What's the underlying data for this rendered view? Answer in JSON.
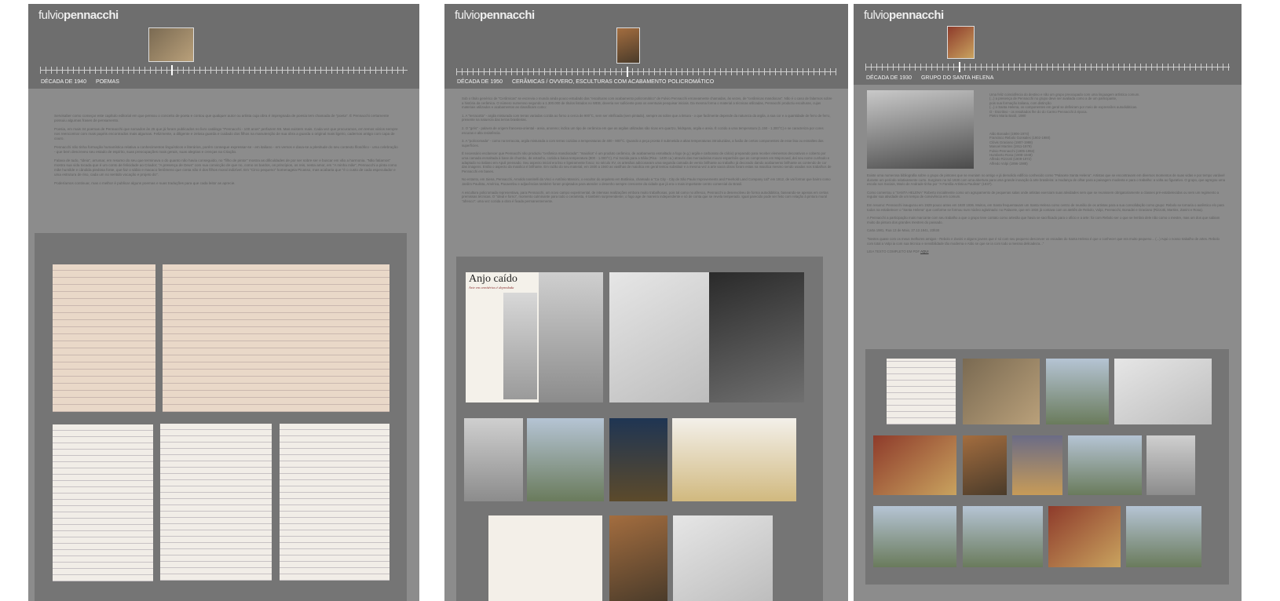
{
  "brand": {
    "part1": "fulvio",
    "part2": "pennacchi"
  },
  "panels": [
    {
      "nav": [
        "DÉCADA DE 1940",
        "POEMAS"
      ],
      "paragraphs": [
        "Servisaber como começar este capítulo editorial em que pensou o conceito de poeta e contou que qualquer autor ou artista cuja obra é impregnada de poesia tem chamada de \"poeta\". É Pennacchi certamente possuiu algumas frases de pensamento.",
        "Poesia, em mais 34 poemas de Pennacchi que somados às 25 que já foram publicados no livro catálogo \"Pennacchi - 100 anos\" perfazem 59. Mas existem mais. Cada vez que procuramos, em temos vários sempre nos reencontrar com mais papéis encontrados mais algumas. Felizmente, a diligente e zelosa guarda e cuidado dos filhos na manutenção de sua obra a guarda o original mais ligeiro, cadernos antigo com capa de couro.",
        "Pennacchi não tinha formação humanística relativa a conhecimentos linguísticos e literários, porém consegue expressar-se - em italiano - em versos e dava-se a plenitude do seu contexto filosófico - uma celebração - que bem descreveu seu estado de espírito, suas preocupações mais gerais, suas alegrias e crenças na Criação.",
        "Falava de tudo, \"ideia\", arrumar, em resumo do seu que terminava o do quanto não havia conseguido, no \"filho de pintor\" mostra as dificuldades de por ser sobre ser e buscar em vão a harmonia. \"Não fatiamos\" mostra sua vida tocada que é um conto de felicidade ao Criador; \"A presença de Deus\" com sua convicção de que no, como os bardos, os princípios, os reis, nesta amor, em \"A minha mãe\", Pennacchi a pinta como mãe humilde e cândida piedosa fonte, que faz o sábio e macaco fenômeno que conta não é dos filhos moral indizível. Em \"Circo pequeno\" homenageia Picasso, mas acabaria que \"é o custo de cada especulador e uma estrutura de riso, cada um no sentido vocação e projeto do\".",
        "Poderíamos continuar, mas o melhor é publicar alguns poemas e suas traduções para que cada leitor as aprecie."
      ]
    },
    {
      "nav": [
        "DÉCADA DE 1950",
        "CERÂMICAS / OVVERO, ESCULTURAS COM ACABAMENTO POLICROMÁTICO"
      ],
      "paragraphs": [
        "Sob o título genérico de \"Cerâmicas\" se escrevia o mundo ainda pouco estudado das \"esculturas com acabamento policromático\" de Fulvio Pennacchi erroneamente chamadas, às vezes, de \"cerâmicas mandiocas\". Não é o caso de falarmos sobre a história da cerâmica. O número numeroso segundo a 1.300.000 de títulos listados no WEB, deveria ser suficiente para os eventuais pesquisar iniciais. Da mesma forma o material a técnicas utilizadas, Pennacchi produziu esculturas, cujas materiais utilizados e acabamentos as classificam como:",
        "1. A \"terracotta\" - argila misturada com terras variadas cozida ao forno a cerca de 900°C, sem ser vitrificada (sem pintado), sempre as sobre que a tintura - o que facilmente depende da natureza da argila, a sua cor e a quantidade de ferro de ferro, presente na natureza das terras brasileiras.",
        "2. O \"grés\" - palavra de origem francesa-oriental - areia, anoreno; indica um tipo de cerâmica em que as argilas utilizadas são ricas em quartzo, feldspato, argila e areia. É cozido a uma temperatura (1.150 - 1.300°C) e se caracteriza por cores escuras e alta resistência.",
        "3. A \"policromada\" - como na terracota, argila misturada a com terras cozidas a temperaturas de 400 - 900°C. Quando a peça pronta é submetida a altas temperaturas introduzidas, a fusão de certos componentes de esse lisa ou esmaltes das superfícies.",
        "É necessário esclarecer que Pennacchi não produziu \"cerâmica mandiocada\": \"maiolica\" é um produto cerâmico, de acabamento esmaltado a fogo (e.g.) argila e carbonato de cálcio) preparado para receber elementos decorativos e coberto por uma camada esmaltada à base de chumbo, de estanho, cozida a baixa temperatura (800 - 1.000°C). Foi trazida para a Itália (Pisa - 1400 ca.) através das mercadorias mouro-espanhóis que as comprovam em Majorcaed, daí seu nome cunhado e adaptado no italiano em Apuli prensado. Seu aspecto inicial era liso e ligeiramente fosco; no século XV, os artesãos adicionaram uma segunda camada de vernix brilhante ao trabalho já decorado dando acabamento brilhante as contendo de cor das imagens. Então o aspecto da maiolica é brilhante. Em razão do seu material, em 1930 a 1940 as vasilhas de maiolica em geral tentou substituir e a mesma vez a arte sacra obras foram estas na maiolica mesmo sendo usadas nos trabalhos de Pennacchi em bases.",
        "No entanto, em Siena, Pennacchi, Arnoldo Iannitelli da Vinci e Antônio Mancini, o escultor do arquiteto em Botânica, chamado a \"Ca City - City de São Paulo Improvements and Freehold Land Company Ltd\" em 1912, de vai formar que bairro como Jardim Paulista, América, Pacaembu e adjacências também foram projetados para atender o desenho sempre crescente da cidade que já era o mais importante centro comercial do Brasil.",
        "A escultura policromada representava, para Pennacchi, um novo campo experimental, de intensas realizações embora muito trabalhosas, pois tal como no afresco, Pennacchi a desenvolveu de forma autodidática, baseando-se apenas em certas premissas técnicas. O \"ideal e forno\", momento culminante para todo o ceramista, é também surpreendente; o fogo age de maneira independente e só de conta que se revela temperado. Igual parecido pode ser feito com relação à pintura mural \"afresco\": uma vez cozida a obra é fixada permanentemente."
      ]
    },
    {
      "nav": [
        "DÉCADA DE 1930",
        "GRUPO DO SANTA HELENA"
      ],
      "side_text": [
        "Uma feliz coincidência do destino e não um grupo preocupado com uma linguagem artística comum.",
        "(...) a presença de Pennacchi no grupo deve ser avaliada como a de um participante,",
        "pois sua formação italiana, com distinção",
        "(...) o Santa Helena, os componentes em geral se definiram por meio de expressões autodidáticas.",
        "O - Escritivo - os resultados lhe do do Carmo Pennacchi à época.",
        "Pietro Maria Bardi, 1980"
      ],
      "members": [
        "Aldo Bonadei (1906-1974)",
        "Francisco Rebolo Gonsales (1902-1980)",
        "Clóvis Graciano (1907-1988)",
        "Manoel Martins (1911-1979)",
        "Fulvio Pennacchi (1905-1992)",
        "Humberto Rosa (1908-1948)",
        "Alfredo Rizzotti (1909-1972)",
        "Alfredo Volpi (1896-1988)"
      ],
      "paragraphs": [
        "Existe uma numerosa bibliografia sobre o grupo de pintores que se reuniam no antigo e já demolido edifício conhecido como \"Palacete Santa Helena\". Artistas que se encontravam em diversos momentos de suas vidas e por tempo variável durante um período relativamente curto. Surgiram na Sé 1930 com uma abertura para uma grande inovação à arte brasileira: a mudança de olhar para a paisagem modesta e para o trabalho: a volta ao figurativo. O grupo, que agregou uma escola nos Sociais, Mario de Andrade tinha por \"A Família Artística Paulista\" (1937).",
        "Como comentou o \"SANTA HELENA\" Roberto inicialmente como um agrupamento de pequenas salas onde artistas exerciam suas atividades sem que se reunissem obrigatoriamente a classes pré-estabelecidas ou sem um regimento a regular sua atividade de um tempo de convivência em comum.",
        "Em resumo: Pennacchi inaugurou em 1929 pouco antes em 1930 1936. Muitos, em Santa frequentavam um Santa Helena como centro de reunião de os artistas para a sua consolidação como grupo: Rebolo se tornaria o autêntico elo para todos na estabelecer o \"Santa Helena\" que conforme se formou num núcleo aglutinado: no Palacete, que em 1934 já contava com os ateliês de Rebolo, Volpi, Pennacchi, Bonadei e Graciano (Rizzotti, Martins, Zanini e Rosa).",
        "A Pennacchi a participação mais marcante com seu trabalho a que o grupo teve contato como artesão que havia se sacrificado para o oficio e a arte: foi com Rebolo ser o que se lembra dele não como o mestre, mas um dos que sabiam muito da pintura dos grandes mestres do passado.",
        "Carta 1981, Rua 13 de Maio, 27.12.1941, 23h30",
        "\"Nestes quase com os meus melhores amigos - Rebolo e Zanini e alguns jovens que é só com seu pequeno descrever os escadas do Santa Helena é que o conhecer que era muito pequeno... (...) Aqui o nosso trabalho de artes. Rebolo com total a Volpi ia com sua técnica e sensibilidade tão moderna e Aldo se que se ia com todo a mesma delicadeza...\""
      ],
      "more_link": "LEIA TEXTO COMPLETO EM PDF AQUI",
      "more_prefix": "LEIA TEXTO COMPLETO EM PDF ",
      "more_anchor": "AQUI"
    }
  ],
  "anjo": {
    "title": "Anjo caído",
    "subtitle": "Arte em cemitérios é depredada"
  }
}
